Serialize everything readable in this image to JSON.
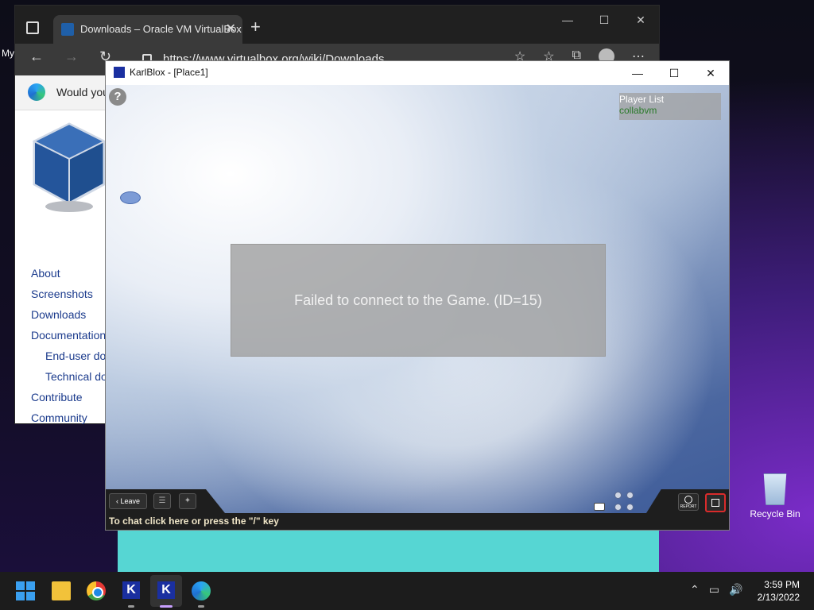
{
  "desktop": {
    "left_label": "My",
    "recycle_bin_label": "Recycle Bin"
  },
  "browser": {
    "tab_title": "Downloads – Oracle VM VirtualBox",
    "address": "https://www.virtualbox.org/wiki/Downloads",
    "infobar_text": "Would you",
    "nav_items": [
      "About",
      "Screenshots",
      "Downloads",
      "Documentation",
      "End-user do",
      "Technical do",
      "Contribute",
      "Community"
    ]
  },
  "game": {
    "window_title": "KarlBlox - [Place1]",
    "help_label": "?",
    "player_list_title": "Player List",
    "players": [
      "collabvm"
    ],
    "error_message": "Failed to connect to the Game. (ID=15)",
    "leave_label": "Leave",
    "report_label": "REPORT",
    "chat_hint": "To chat click here or press the \"/\" key"
  },
  "taskbar": {
    "time": "3:59 PM",
    "date": "2/13/2022"
  },
  "colors": {
    "teal_window": "#56d6d3",
    "karlblox_brand": "#1a2fa0",
    "fullscreen_highlight": "#d92b2b"
  }
}
